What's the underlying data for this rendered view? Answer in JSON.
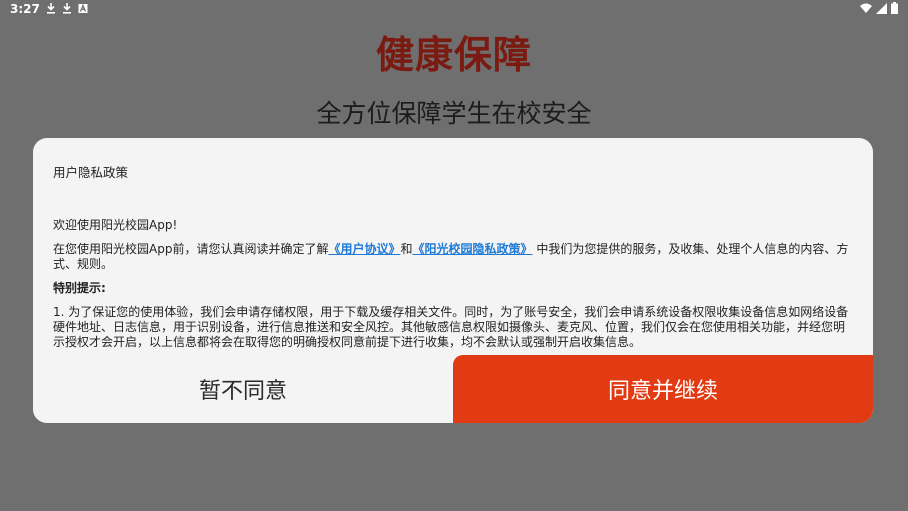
{
  "status_bar": {
    "time": "3:27",
    "left_icons": [
      "download-icon",
      "download-icon",
      "a-icon"
    ],
    "right_icons": [
      "wifi-icon",
      "signal-icon",
      "battery-icon"
    ]
  },
  "screen": {
    "title": "健康保障",
    "subtitle": "全方位保障学生在校安全",
    "title_color": "#7a1a10"
  },
  "dialog": {
    "title": "用户隐私政策",
    "welcome": "欢迎使用阳光校园App!",
    "intro_before": "在您使用阳光校园App前，请您认真阅读并确定了解",
    "link_user_agreement": "《用户协议》",
    "conj": "和",
    "link_privacy_policy": "《阳光校园隐私政策》",
    "intro_after": " 中我们为您提供的服务，及收集、处理个人信息的内容、方式、规则。",
    "special_heading": "特别提示:",
    "point1": "1. 为了保证您的使用体验，我们会申请存储权限，用于下载及缓存相关文件。同时，为了账号安全，我们会申请系统设备权限收集设备信息如网络设备硬件地址、日志信息，用于识别设备，进行信息推送和安全风控。其他敏感信息权限如摄像头、麦克风、位置，我们仅会在您使用相关功能，并经您明示授权才会开启，以上信息都将会在取得您的明确授权同意前提下进行收集，均不会默认或强制开启收集信息。",
    "decline_label": "暂不同意",
    "accept_label": "同意并继续",
    "accept_color": "#e23a12",
    "link_color": "#1e7ad6"
  }
}
